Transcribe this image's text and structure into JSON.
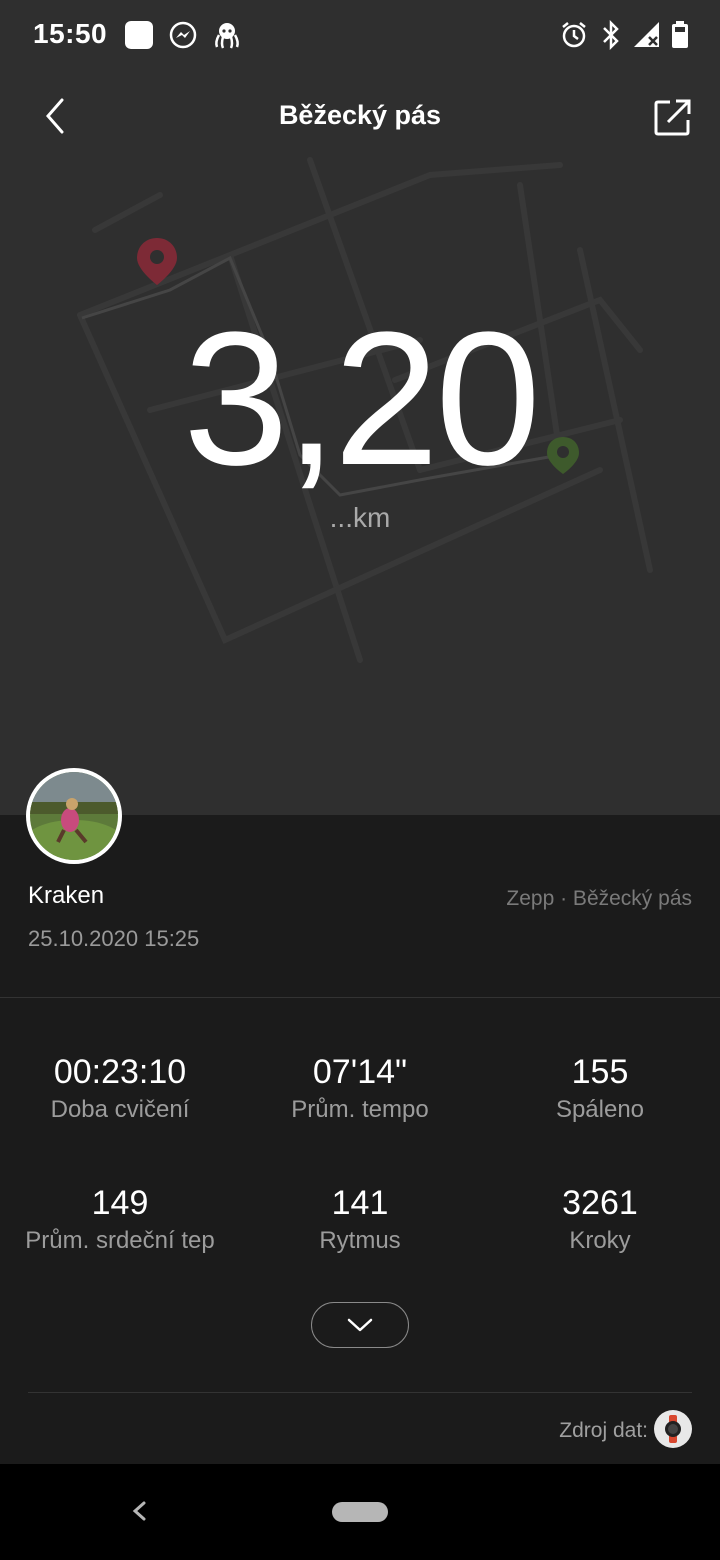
{
  "status_bar": {
    "time": "15:50",
    "left_icons": [
      "app-square-icon",
      "messenger-icon",
      "octopus-icon"
    ],
    "right_icons": [
      "alarm-icon",
      "bluetooth-icon",
      "signal-icon",
      "battery-icon"
    ]
  },
  "header": {
    "title": "Běžecký pás",
    "back_icon": "chevron-left-icon",
    "share_icon": "share-icon"
  },
  "summary": {
    "distance": "3,20",
    "unit": "...km"
  },
  "user": {
    "name": "Kraken",
    "datetime": "25.10.2020 15:25",
    "source": "Zepp · Běžecký pás"
  },
  "stats": [
    {
      "value": "00:23:10",
      "label": "Doba cvičení"
    },
    {
      "value": "07'14\"",
      "label": "Prům. tempo"
    },
    {
      "value": "155",
      "label": "Spáleno"
    },
    {
      "value": "149",
      "label": "Prům. srdeční tep"
    },
    {
      "value": "141",
      "label": "Rytmus"
    },
    {
      "value": "3261",
      "label": "Kroky"
    }
  ],
  "footer": {
    "data_source_label": "Zdroj dat:",
    "expand_icon": "chevron-down-icon"
  },
  "colors": {
    "hero_bg": "#2f2f2f",
    "page_bg": "#1b1b1b",
    "start_pin": "#8b2d3a",
    "end_pin": "#3a5a2a"
  }
}
